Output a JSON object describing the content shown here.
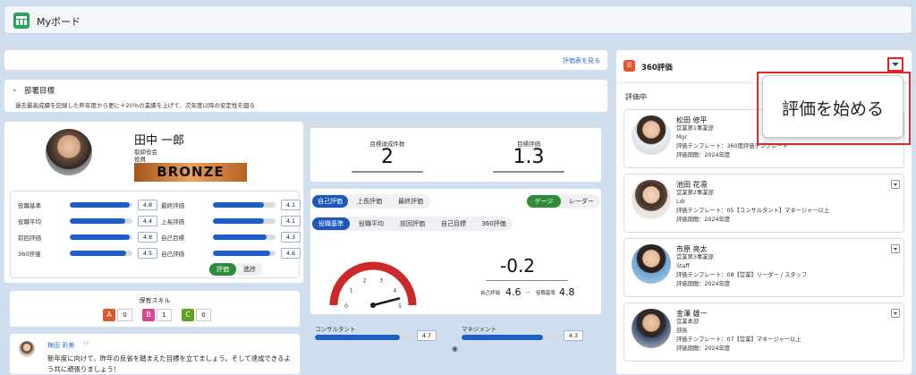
{
  "app": {
    "title": "Myボード"
  },
  "header": {
    "view_sheet_link": "評価表を見る"
  },
  "goal": {
    "heading": "部署目標",
    "text": "過去最高成績を記録した昨年度から更に＋20％の業績を上げて、次年度以降の安定性を図る"
  },
  "profile": {
    "name": "田中 一郎",
    "department": "取締役会",
    "role": "役員",
    "rank": "BRONZE"
  },
  "metrics_left": [
    {
      "label": "役職基準",
      "value": "4.8",
      "fill": 0.95
    },
    {
      "label": "役職平均",
      "value": "4.4",
      "fill": 0.88
    },
    {
      "label": "前回評価",
      "value": "4.8",
      "fill": 0.95
    },
    {
      "label": "360評価",
      "value": "4.5",
      "fill": 0.9
    }
  ],
  "metrics_right": [
    {
      "label": "最終評価",
      "value": "4.1",
      "fill": 0.82
    },
    {
      "label": "上長評価",
      "value": "4.1",
      "fill": 0.82
    },
    {
      "label": "自己目標",
      "value": "4.3",
      "fill": 0.86
    },
    {
      "label": "自己評価",
      "value": "4.6",
      "fill": 0.92
    }
  ],
  "metric_toggle": {
    "active": "評価",
    "inactive": "進捗"
  },
  "skills": {
    "title": "保有スキル",
    "items": [
      {
        "grade": "A",
        "count": "0",
        "color": "#e2572b"
      },
      {
        "grade": "B",
        "count": "1",
        "color": "#d6478f"
      },
      {
        "grade": "C",
        "count": "0",
        "color": "#5ea31f"
      }
    ]
  },
  "comment": {
    "author": "梅田 彩美",
    "text": "新年度に向けて、昨年の反省を踏まえた目標を立てましょう。そして達成できるよう共に頑張りましょう！"
  },
  "stats": {
    "goal_count_label": "目標達成件数",
    "goal_count": "2",
    "goal_eval_label": "目標評価",
    "goal_eval": "1.3"
  },
  "eval_tabs": {
    "items": [
      "自己評価",
      "上長評価",
      "最終評価"
    ],
    "active": 0
  },
  "view_toggle": {
    "items": [
      "ゲージ",
      "レーダー"
    ],
    "active": 0
  },
  "compare_tabs": {
    "items": [
      "役職基準",
      "役職平均",
      "前回評価",
      "自己目標",
      "360評価"
    ],
    "active": 0
  },
  "gauge": {
    "ticks": [
      "0",
      "1",
      "2",
      "3",
      "4",
      "5"
    ],
    "value": 4.6,
    "min": 0,
    "max": 5
  },
  "diff": {
    "value": "-0.2",
    "self_label": "自己評価",
    "self_value": "4.6",
    "sep": "—",
    "base_label": "役職基準",
    "base_value": "4.8"
  },
  "skills_bars": [
    {
      "label": "コンサルタント",
      "value": "4.7",
      "fill": 0.9
    },
    {
      "label": "マネジメント",
      "value": "4.3",
      "fill": 0.86
    }
  ],
  "right": {
    "title": "360評価",
    "section": "評価中",
    "people": [
      {
        "name": "松田 修平",
        "dept": "営業第1事業部",
        "role": "Mgr",
        "template": "評価テンプレート：360度評価テンプレート",
        "period": "評価期間：2024年度"
      },
      {
        "name": "池田 花凛",
        "dept": "営業第2事業部",
        "role": "Ldr",
        "template": "評価テンプレート：05【コンサルタント】マネージャー以上",
        "period": "評価期間：2024年度"
      },
      {
        "name": "市原 亮太",
        "dept": "営業第3事業部",
        "role": "Staff",
        "template": "評価テンプレート：08【営業】リーダー / スタッフ",
        "period": "評価期間：2024年度"
      },
      {
        "name": "金澤 雄一",
        "dept": "営業本部",
        "role": "部長",
        "template": "評価テンプレート：07【営業】マネージャー以上",
        "period": "評価期間：2024年度"
      }
    ]
  },
  "popup": {
    "label": "評価を始める"
  },
  "colors": {
    "accent": "#1d57b8",
    "green": "#2e8b3b",
    "highlight": "#e0262a",
    "bronze": "#c87a35"
  }
}
